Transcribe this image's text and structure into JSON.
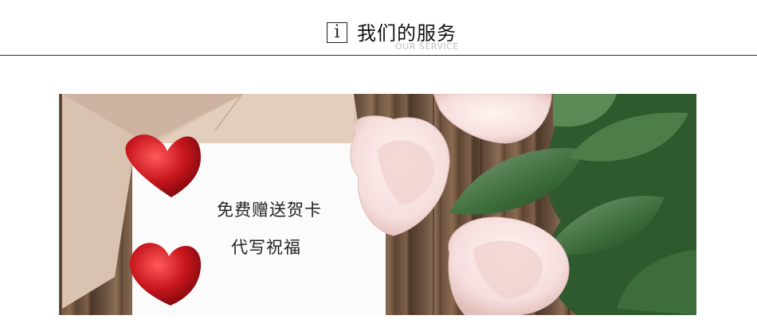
{
  "section_header": {
    "icon": "info-icon",
    "title": "我们的服务",
    "subtitle": "OUR SERVICE"
  },
  "banner": {
    "card_line_1": "免费赠送贺卡",
    "card_line_2": "代写祝福",
    "decorations": [
      "heart-icon",
      "heart-icon",
      "envelope",
      "rose"
    ],
    "colors": {
      "heart": "#c8161d",
      "card": "#fbfbfb",
      "envelope": "#d9c2b0",
      "rose_petal": "#f5dedd",
      "leaf": "#3b6b3a",
      "wood": "#6e5440"
    }
  }
}
